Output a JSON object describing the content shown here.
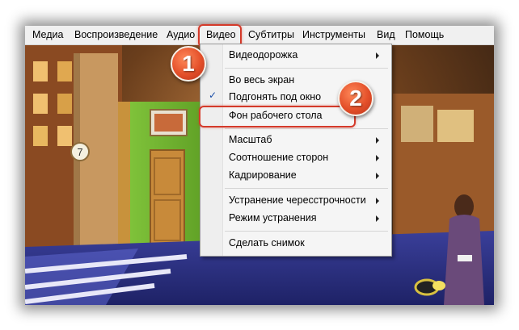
{
  "menubar": {
    "items": [
      "Медиа",
      "Воспроизведение",
      "Аудио",
      "Видео",
      "Субтитры",
      "Инструменты",
      "Вид",
      "Помощь"
    ]
  },
  "video_menu": {
    "items": [
      {
        "label": "Видеодорожка",
        "submenu": true
      },
      {
        "label": "Во весь экран",
        "submenu": false
      },
      {
        "label": "Подгонять под окно",
        "submenu": false,
        "checked": true
      },
      {
        "label": "Фон рабочего стола",
        "submenu": false
      },
      {
        "label": "Масштаб",
        "submenu": true
      },
      {
        "label": "Соотношение сторон",
        "submenu": true
      },
      {
        "label": "Кадрирование",
        "submenu": true
      },
      {
        "label": "Устранение чересстрочности",
        "submenu": true
      },
      {
        "label": "Режим устранения",
        "submenu": true
      },
      {
        "label": "Сделать снимок",
        "submenu": false
      }
    ],
    "check_glyph": "✓"
  },
  "annotations": {
    "step1": "1",
    "step2": "2",
    "highlight_color": "#d43a2a"
  },
  "scene": {
    "clock_digit": "7"
  }
}
